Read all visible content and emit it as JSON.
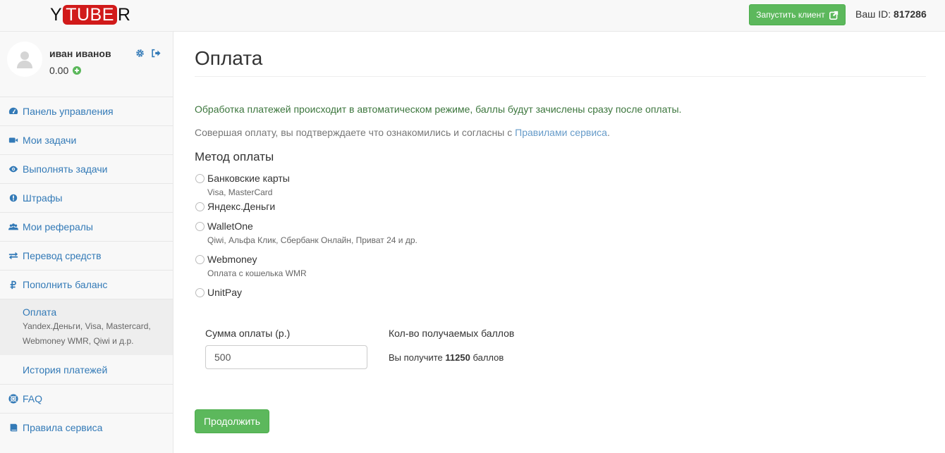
{
  "header": {
    "logo_left": "Y",
    "logo_mid": "TUBE",
    "logo_right": "R",
    "launch_label": "Запустить клиент",
    "user_id_label": "Ваш ID:",
    "user_id_value": "817286"
  },
  "profile": {
    "name": "иван иванов",
    "balance": "0.00"
  },
  "sidebar": {
    "items": [
      {
        "label": "Панель управления",
        "icon": "dashboard-icon"
      },
      {
        "label": "Мои задачи",
        "icon": "video-camera-icon"
      },
      {
        "label": "Выполнять задачи",
        "icon": "eye-icon"
      },
      {
        "label": "Штрафы",
        "icon": "exclamation-circle-icon"
      },
      {
        "label": "Мои рефералы",
        "icon": "users-icon"
      },
      {
        "label": "Перевод средств",
        "icon": "exchange-icon"
      },
      {
        "label": "Пополнить баланс",
        "icon": "ruble-icon"
      }
    ],
    "sub_active": {
      "title": "Оплата",
      "desc1": "Yandex.Деньги, Visa, Mastercard,",
      "desc2": "Webmoney WMR, Qiwi и д.р."
    },
    "sub_item": "История платежей",
    "bottom_items": [
      {
        "label": "FAQ",
        "icon": "life-ring-icon"
      },
      {
        "label": "Правила сервиса",
        "icon": "book-icon"
      }
    ]
  },
  "main": {
    "title": "Оплата",
    "info_green": "Обработка платежей происходит в автоматическом режиме, баллы будут зачислены сразу после оплаты.",
    "info_muted": "Совершая оплату, вы подтверждаете что ознакомились и согласны с",
    "rules_link": "Правилами сервиса",
    "rules_period": ".",
    "method_title": "Метод оплаты",
    "methods": [
      {
        "name": "Банковские карты",
        "desc": "Visa, MasterCard"
      },
      {
        "name": "Яндекс.Деньги",
        "desc": ""
      },
      {
        "name": "WalletOne",
        "desc": "Qiwi, Альфа Клик, Сбербанк Онлайн, Приват 24 и др."
      },
      {
        "name": "Webmoney",
        "desc": "Оплата с кошелька WMR"
      },
      {
        "name": "UnitPay",
        "desc": ""
      }
    ],
    "amount_label": "Сумма оплаты (р.)",
    "amount_value": "500",
    "points_label": "Кол-во получаемых баллов",
    "points_prefix": "Вы получите",
    "points_value": "11250",
    "points_suffix": "баллов",
    "continue_label": "Продолжить"
  },
  "colors": {
    "accent": "#337ab7",
    "success": "#5cb85c",
    "logo_red": "#d11a1a"
  }
}
